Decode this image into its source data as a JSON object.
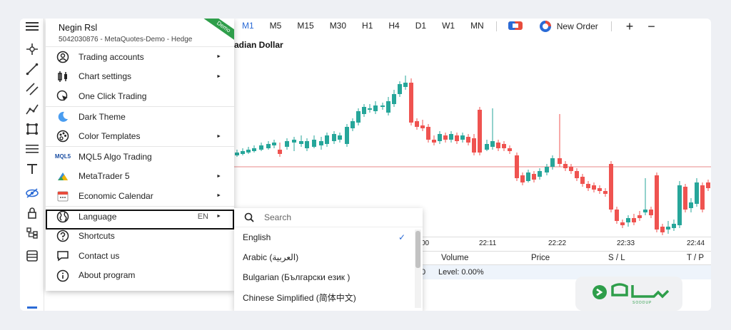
{
  "account": {
    "name": "Negin Rsl",
    "details": "5042030876 - MetaQuotes-Demo - Hedge",
    "badge": "Demo"
  },
  "menu": {
    "items": [
      {
        "label": "Trading accounts",
        "icon": "account-icon",
        "arrow": "►"
      },
      {
        "label": "Chart settings",
        "icon": "chart-settings-icon",
        "arrow": "►"
      },
      {
        "label": "One Click Trading",
        "icon": "one-click-icon"
      },
      {
        "label": "Dark Theme",
        "icon": "moon-icon"
      },
      {
        "label": "Color Templates",
        "icon": "palette-icon",
        "arrow": "►"
      },
      {
        "label": "MQL5 Algo Trading",
        "icon": "mql5-icon",
        "icon_text": "MQL5"
      },
      {
        "label": "MetaTrader 5",
        "icon": "metatrader-icon",
        "arrow": "►"
      },
      {
        "label": "Economic Calendar",
        "icon": "calendar-icon",
        "arrow": "►"
      },
      {
        "label": "Language",
        "icon": "globe-icon",
        "value": "EN",
        "arrow": "►"
      },
      {
        "label": "Shortcuts",
        "icon": "question-icon"
      },
      {
        "label": "Contact us",
        "icon": "chat-icon"
      },
      {
        "label": "About program",
        "icon": "info-icon"
      }
    ]
  },
  "language_menu": {
    "search_placeholder": "Search",
    "items": [
      {
        "label": "English",
        "checked": "✓"
      },
      {
        "label": "Arabic (العربية)"
      },
      {
        "label": "Bulgarian (Български език )"
      },
      {
        "label": "Chinese Simplified (简体中文)"
      }
    ]
  },
  "toolbar": {
    "timeframes": [
      "M1",
      "M5",
      "M15",
      "M30",
      "H1",
      "H4",
      "D1",
      "W1",
      "MN"
    ],
    "selected": "M1",
    "new_order": "New Order",
    "plus": "+",
    "minus": "−"
  },
  "chart": {
    "title": "adian Dollar",
    "time_labels": [
      "00",
      "22:11",
      "22:22",
      "22:33",
      "22:44"
    ],
    "colors": {
      "bull": "#26a69a",
      "bear": "#ef5350",
      "level": "#e88a8a"
    }
  },
  "table": {
    "headers": [
      "Volume",
      "Price",
      "S / L",
      "T / P"
    ],
    "row_prefix": "0",
    "row_text": "Level: 0.00%"
  },
  "watermark": {
    "text": "SODDUP"
  }
}
